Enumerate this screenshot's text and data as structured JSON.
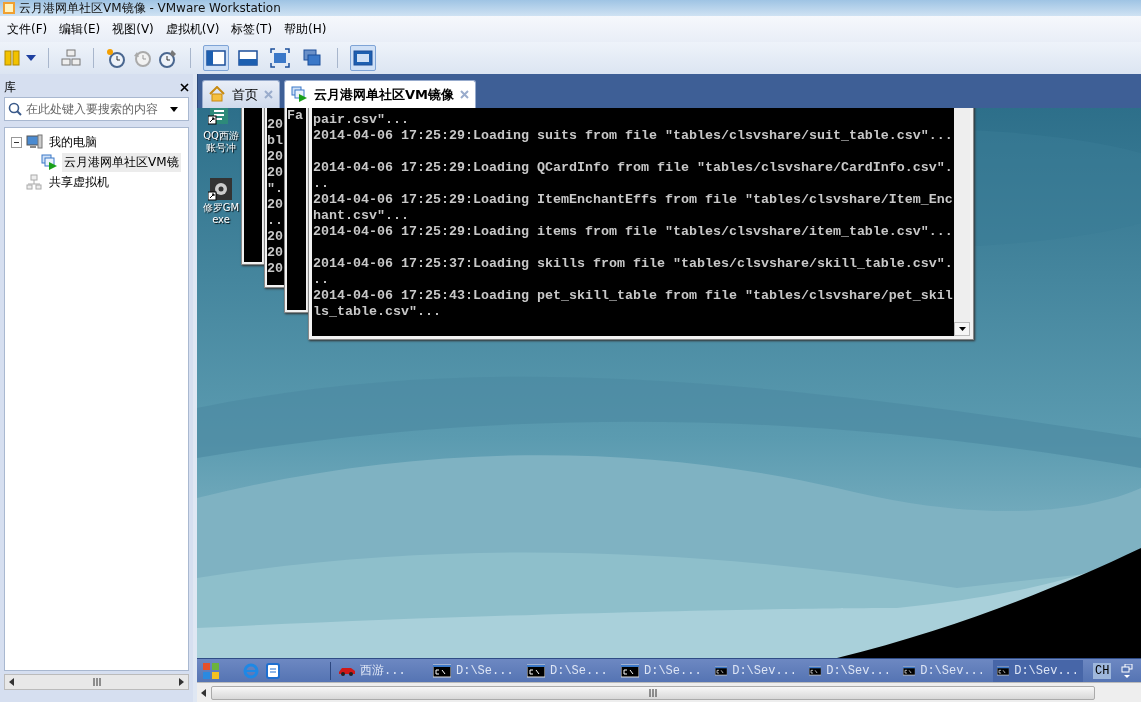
{
  "window": {
    "title": "云月港网单社区VM镜像 - VMware Workstation"
  },
  "menu": [
    "文件(F)",
    "编辑(E)",
    "视图(V)",
    "虚拟机(V)",
    "标签(T)",
    "帮助(H)"
  ],
  "view_buttons": [
    {
      "pressed": true
    },
    {
      "pressed": false
    },
    {
      "pressed": false
    },
    {
      "pressed": false
    },
    {
      "pressed": true
    }
  ],
  "library": {
    "title": "库",
    "search": {
      "placeholder": "在此处键入要搜索的内容"
    },
    "tree": [
      {
        "label": "我的电脑",
        "kind": "computer",
        "expanded": true,
        "selected": false,
        "children": [
          {
            "label": "云月港网单社区VM镜",
            "kind": "vm",
            "selected": true
          }
        ]
      },
      {
        "label": "共享虚拟机",
        "kind": "shared",
        "selected": false
      }
    ]
  },
  "tabs": [
    {
      "label": "首页",
      "kind": "home",
      "selected": false
    },
    {
      "label": "云月港网单社区VM镜像",
      "kind": "vm",
      "selected": true
    }
  ],
  "desktop": {
    "icons": [
      {
        "kind": "shortcut",
        "lines": [
          "QQ西游",
          "账号冲"
        ]
      },
      {
        "kind": "gear",
        "lines": [
          "修罗GM",
          "exe"
        ]
      }
    ],
    "back_consoles": [
      {
        "kind": "console"
      },
      {
        "kind": "console",
        "lines": [
          "20",
          "bl",
          "20",
          "20",
          "\".",
          "20",
          "..",
          "20",
          "20",
          "20"
        ]
      },
      {
        "kind": "console",
        "lines": [
          "Fa"
        ]
      }
    ],
    "console": {
      "lines": [
        {
          "kind": "text",
          "text": "pair.csv\"..."
        },
        {
          "kind": "text",
          "text": "2014-04-06 17:25:29:Loading suits from file \"tables/clsvshare/suit_table.csv\"..."
        },
        {
          "kind": "blank"
        },
        {
          "kind": "text",
          "text": "2014-04-06 17:25:29:Loading QCardInfo from file \"tables/clsvshare/CardInfo.csv\"."
        },
        {
          "kind": "text",
          "text": ".."
        },
        {
          "kind": "text",
          "text": "2014-04-06 17:25:29:Loading ItemEnchantEffs from file \"tables/clsvshare/Item_Enc"
        },
        {
          "kind": "text",
          "text": "hant.csv\"..."
        },
        {
          "kind": "text",
          "text": "2014-04-06 17:25:29:Loading items from file \"tables/clsvshare/item_table.csv\"..."
        },
        {
          "kind": "blank"
        },
        {
          "kind": "text",
          "text": "2014-04-06 17:25:37:Loading skills from file \"tables/clsvshare/skill_table.csv\"."
        },
        {
          "kind": "text",
          "text": ".."
        },
        {
          "kind": "text",
          "text": "2014-04-06 17:25:43:Loading pet_skill_table from file \"tables/clsvshare/pet_skil"
        },
        {
          "kind": "text",
          "text": "ls_table.csv\"..."
        }
      ]
    }
  },
  "taskbar": {
    "items": [
      {
        "kind": "car",
        "label": "西游...",
        "selected": false
      },
      {
        "kind": "console",
        "label": "D:\\Se...",
        "selected": false
      },
      {
        "kind": "console",
        "label": "D:\\Se...",
        "selected": false
      },
      {
        "kind": "console",
        "label": "D:\\Se...",
        "selected": false
      },
      {
        "kind": "console",
        "label": "D:\\Sev...",
        "selected": false
      },
      {
        "kind": "console",
        "label": "D:\\Sev...",
        "selected": false
      },
      {
        "kind": "console",
        "label": "D:\\Sev...",
        "selected": false
      },
      {
        "kind": "console",
        "label": "D:\\Sev...",
        "selected": true
      }
    ],
    "language": "CH"
  }
}
